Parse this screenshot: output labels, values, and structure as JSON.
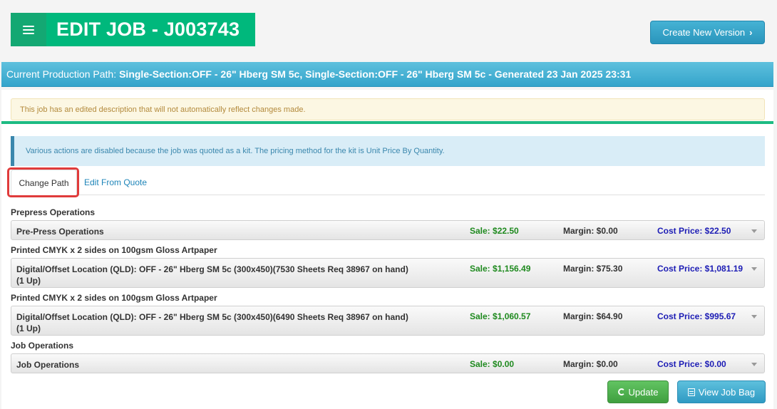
{
  "header": {
    "title": "EDIT JOB - J003743",
    "menu_icon": "hamburger-menu-icon",
    "create_version_label": "Create New Version",
    "create_version_icon": "chevron-right-icon"
  },
  "production_path": {
    "label": "Current Production Path:",
    "value": "Single-Section:OFF - 26\" Hberg SM 5c, Single-Section:OFF - 26\" Hberg SM 5c - Generated 23 Jan 2025 23:31"
  },
  "alerts": {
    "warning": "This job has an edited description that will not automatically reflect changes made.",
    "info": "Various actions are disabled because the job was quoted as a kit. The pricing method for the kit is Unit Price By Quantity."
  },
  "tabs": {
    "change_path": "Change Path",
    "edit_from_quote": "Edit From Quote"
  },
  "sections": [
    {
      "heading": "Prepress Operations",
      "row": {
        "name": "Pre-Press Operations",
        "sale": "Sale: $22.50",
        "margin": "Margin: $0.00",
        "cost": "Cost Price: $22.50"
      }
    },
    {
      "heading": "Printed CMYK x 2 sides on 100gsm Gloss Artpaper",
      "row": {
        "name": "Digital/Offset Location (QLD): OFF - 26\" Hberg SM 5c (300x450)(7530 Sheets Req 38967 on hand) (1 Up)",
        "sale": "Sale: $1,156.49",
        "margin": "Margin: $75.30",
        "cost": "Cost Price: $1,081.19"
      }
    },
    {
      "heading": "Printed CMYK x 2 sides on 100gsm Gloss Artpaper",
      "row": {
        "name": "Digital/Offset Location (QLD): OFF - 26\" Hberg SM 5c (300x450)(6490 Sheets Req 38967 on hand) (1 Up)",
        "sale": "Sale: $1,060.57",
        "margin": "Margin: $64.90",
        "cost": "Cost Price: $995.67"
      }
    },
    {
      "heading": "Job Operations",
      "row": {
        "name": "Job Operations",
        "sale": "Sale: $0.00",
        "margin": "Margin: $0.00",
        "cost": "Cost Price: $0.00"
      }
    }
  ],
  "footer": {
    "update_label": "Update",
    "update_icon": "refresh-icon",
    "view_job_bag_label": "View Job Bag",
    "view_job_bag_icon": "list-icon"
  },
  "colors": {
    "title_green": "#00b87c",
    "path_blue": "#34a4cb",
    "sale_green": "#1f8a1f",
    "cost_blue": "#1c1cb5",
    "highlight_red": "#e03b3b"
  }
}
